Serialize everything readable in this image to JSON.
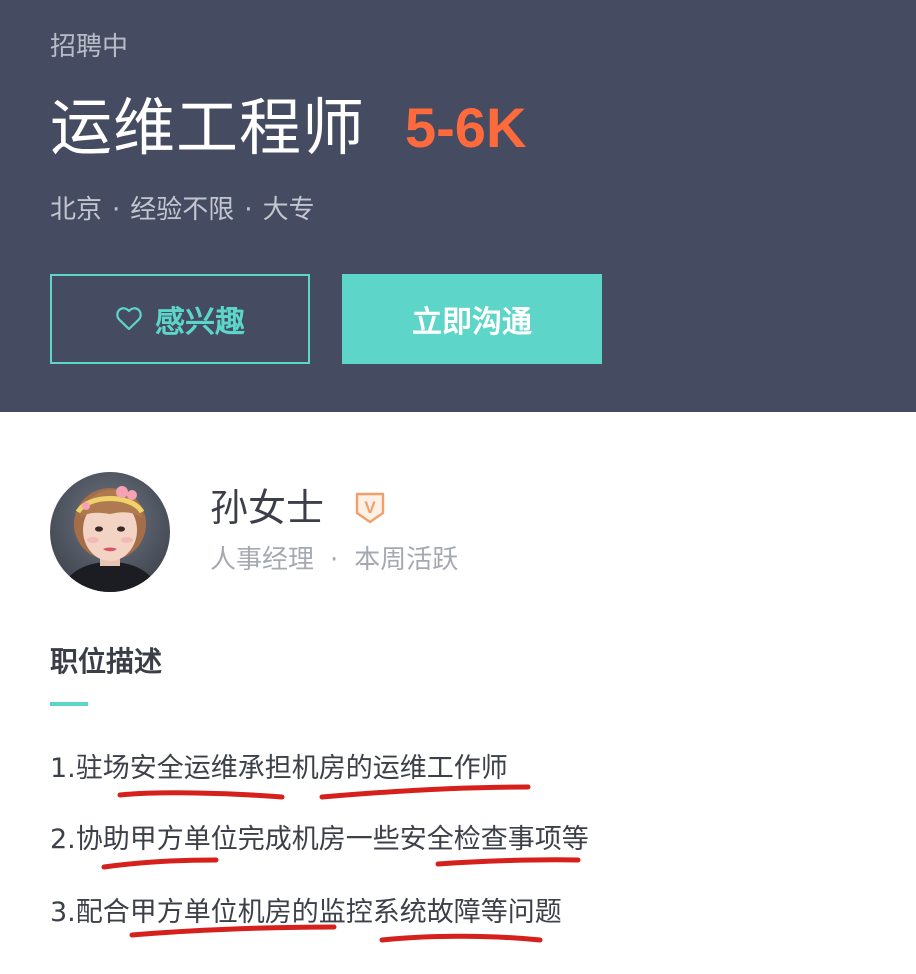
{
  "header": {
    "status": "招聘中",
    "job_title": "运维工程师",
    "salary": "5-6K",
    "meta": {
      "city": "北京",
      "experience": "经验不限",
      "education": "大专",
      "separator": "·"
    },
    "buttons": {
      "interest_label": "感兴趣",
      "chat_label": "立即沟通"
    }
  },
  "recruiter": {
    "name": "孙女士",
    "badge_letter": "V",
    "role": "人事经理",
    "activity": "本周活跃",
    "separator": "·"
  },
  "description": {
    "title": "职位描述",
    "lines": [
      "1.驻场安全运维承担机房的运维工作师",
      "2.协助甲方单位完成机房一些安全检查事项等",
      "3.配合甲方单位机房的监控系统故障等问题"
    ]
  },
  "colors": {
    "header_bg": "#454b61",
    "accent": "#5dd5c8",
    "salary": "#ff6a3d",
    "badge": "#f2a06a",
    "annotation": "#d6201c"
  },
  "icons": {
    "interest": "heart-outline-icon",
    "verified": "verified-v-badge-icon"
  }
}
